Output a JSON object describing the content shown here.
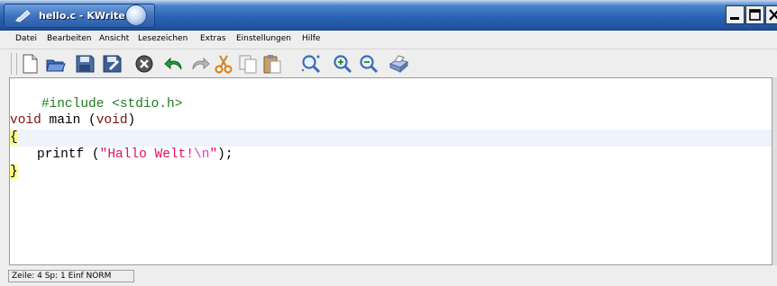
{
  "window": {
    "title": "hello.c - KWrite",
    "app_icon": "kwrite-pen-icon",
    "desktop_icon": "kde-desktop-icon",
    "buttons": [
      "minimize-icon",
      "maximize-icon",
      "close-icon"
    ],
    "accent_color": "#2a64b6"
  },
  "menu": {
    "items": [
      "Datei",
      "Bearbeiten",
      "Ansicht",
      "Lesezeichen",
      "Extras",
      "Einstellungen",
      "Hilfe"
    ]
  },
  "toolbar": {
    "icons": [
      "new-document-icon",
      "open-folder-icon",
      "save-icon",
      "save-as-icon",
      "close-document-icon",
      "undo-icon",
      "redo-icon",
      "cut-icon",
      "copy-icon",
      "paste-icon",
      "find-icon",
      "find-next-icon",
      "replace-icon",
      "print-icon"
    ]
  },
  "editor": {
    "lines": [
      {
        "parts": [
          {
            "t": "#include <stdio.h>",
            "c": "pre"
          }
        ]
      },
      {
        "parts": []
      },
      {
        "parts": [
          {
            "t": "void",
            "c": "type"
          },
          {
            "t": " main ",
            "c": "plain"
          },
          {
            "t": "(",
            "c": "plain"
          },
          {
            "t": "void",
            "c": "type"
          },
          {
            "t": ")",
            "c": "plain"
          }
        ]
      },
      {
        "parts": [
          {
            "t": "{",
            "c": "brace"
          }
        ],
        "active": true
      },
      {
        "parts": [
          {
            "t": "printf (",
            "c": "plain"
          },
          {
            "t": "\"Hallo Welt!",
            "c": "str"
          },
          {
            "t": "\\n",
            "c": "esc"
          },
          {
            "t": "\"",
            "c": "str"
          },
          {
            "t": ");",
            "c": "plain"
          }
        ],
        "indent": true
      },
      {
        "parts": [
          {
            "t": "}",
            "c": "brace"
          }
        ]
      }
    ],
    "line_1": "#include <stdio.h>",
    "line_3_kw1": "void",
    "line_3_mid": " main (",
    "line_3_kw2": "void",
    "line_3_end": ")",
    "line_4": "{",
    "line_5_a": "printf (",
    "line_5_str": "\"Hallo Welt!",
    "line_5_esc": "\\n",
    "line_5_q": "\"",
    "line_5_end": ");",
    "line_6": "}"
  },
  "status": {
    "position": "Zeile: 4 Sp: 1  Einf  NORM"
  }
}
